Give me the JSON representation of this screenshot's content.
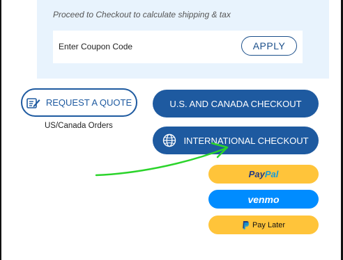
{
  "cart": {
    "shipping_note": "Proceed to Checkout to calculate shipping & tax",
    "coupon_label": "Enter Coupon Code",
    "apply_label": "APPLY"
  },
  "quote": {
    "button_label": "REQUEST A QUOTE",
    "note": "US/Canada Orders"
  },
  "checkout": {
    "us_canada_label": "U.S. AND CANADA CHECKOUT",
    "international_label": "INTERNATIONAL CHECKOUT"
  },
  "payments": {
    "paypal_part1": "Pay",
    "paypal_part2": "Pal",
    "venmo_label": "venmo",
    "pay_later_label": "Pay Later"
  },
  "colors": {
    "primary_blue": "#1e5aa0",
    "panel_bg": "#e8f3fd",
    "paypal_yellow": "#ffc43a",
    "venmo_blue": "#008cff",
    "annotation_green": "#2bd42b"
  },
  "icons": [
    "request-quote-icon",
    "globe-icon",
    "paypal-p-icon"
  ]
}
